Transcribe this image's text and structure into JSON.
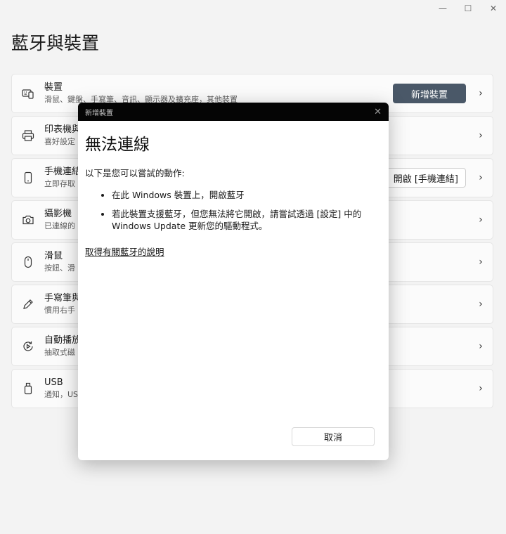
{
  "window": {
    "minimize": "—",
    "maximize": "☐",
    "close": "✕"
  },
  "page_title": "藍牙與裝置",
  "rows": [
    {
      "title": "裝置",
      "subtitle": "滑鼠、鍵盤、手寫筆、音訊、顯示器及擴充座，其他裝置",
      "icon": "devices-icon",
      "action": "新增裝置"
    },
    {
      "title": "印表機與",
      "subtitle": "喜好設定"
    },
    {
      "title": "手機連結",
      "subtitle": "立即存取",
      "action": "開啟 [手機連結]"
    },
    {
      "title": "攝影機",
      "subtitle": "已連線的"
    },
    {
      "title": "滑鼠",
      "subtitle": "按鈕、滑"
    },
    {
      "title": "手寫筆與",
      "subtitle": "慣用右手"
    },
    {
      "title": "自動播放",
      "subtitle": "抽取式磁"
    },
    {
      "title": "USB",
      "subtitle": "通知，US"
    }
  ],
  "dialog": {
    "caption": "新增裝置",
    "heading": "無法連線",
    "intro": "以下是您可以嘗試的動作:",
    "bullets": [
      "在此 Windows 裝置上，開啟藍牙",
      "若此裝置支援藍牙，但您無法將它開啟，請嘗試透過 [設定] 中的 Windows Update 更新您的驅動程式。"
    ],
    "link": "取得有關藍牙的說明",
    "cancel": "取消"
  }
}
